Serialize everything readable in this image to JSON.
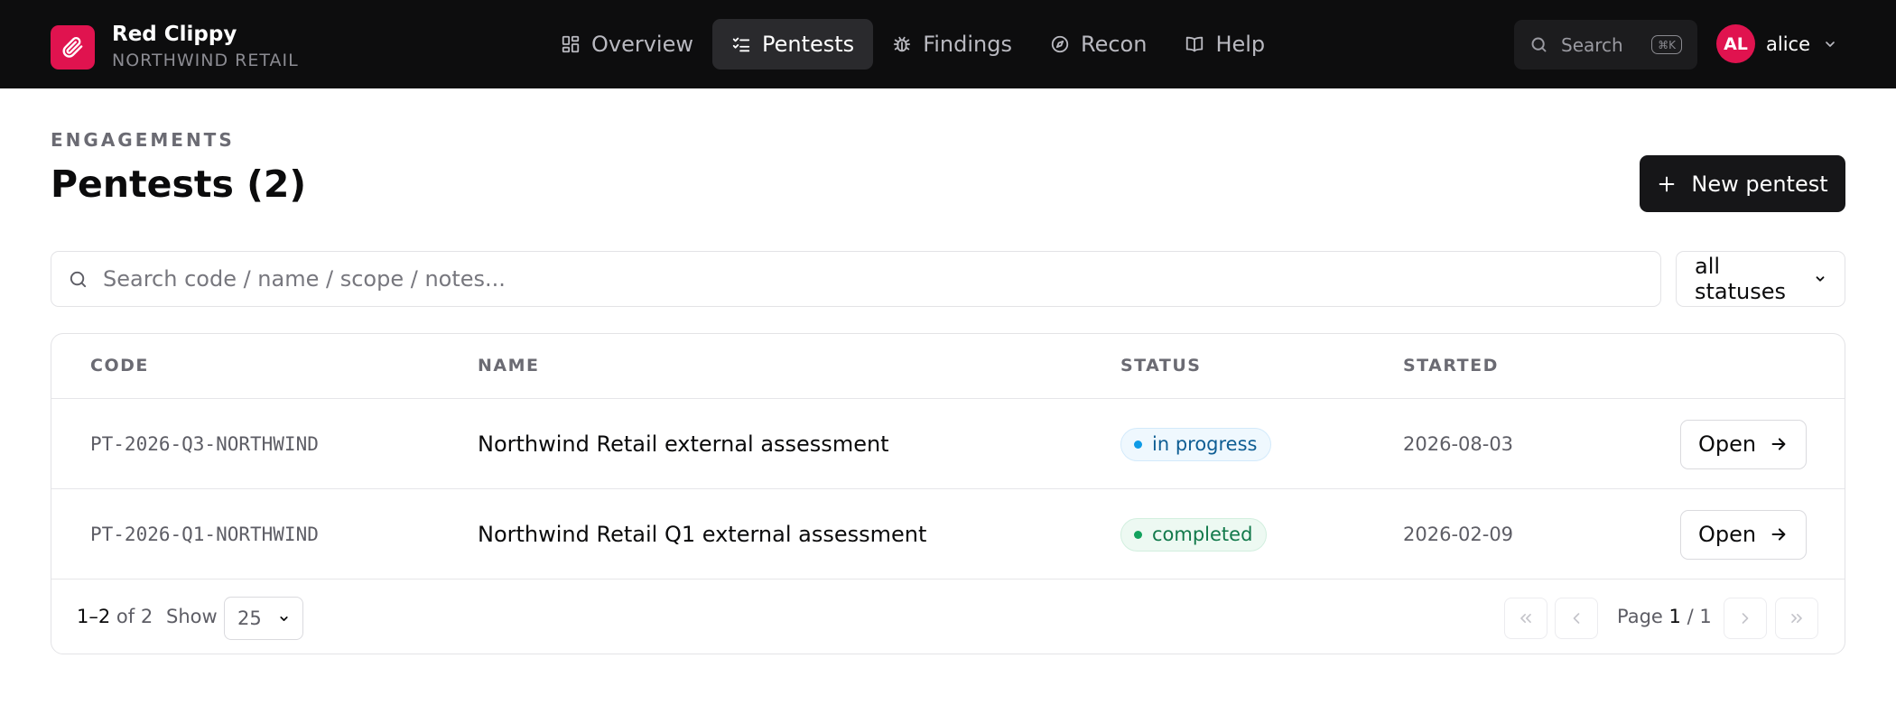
{
  "brand": {
    "name": "Red Clippy",
    "org": "NORTHWIND RETAIL",
    "logo_icon": "paperclip-icon"
  },
  "nav": {
    "items": [
      {
        "label": "Overview",
        "icon": "grid-icon"
      },
      {
        "label": "Pentests",
        "icon": "checklist-icon",
        "active": true
      },
      {
        "label": "Findings",
        "icon": "bug-icon"
      },
      {
        "label": "Recon",
        "icon": "compass-icon"
      },
      {
        "label": "Help",
        "icon": "book-icon"
      }
    ]
  },
  "global_search": {
    "label": "Search",
    "shortcut": "⌘K"
  },
  "user": {
    "initials": "AL",
    "name": "alice"
  },
  "page": {
    "eyebrow": "ENGAGEMENTS",
    "title": "Pentests (2)",
    "new_button": "New pentest"
  },
  "filters": {
    "search_placeholder": "Search code / name / scope / notes...",
    "status_selected": "all statuses"
  },
  "table": {
    "columns": [
      "CODE",
      "NAME",
      "STATUS",
      "STARTED"
    ],
    "rows": [
      {
        "code": "PT-2026-Q3-NORTHWIND",
        "name": "Northwind Retail external assessment",
        "status": "in progress",
        "started": "2026-08-03",
        "action": "Open"
      },
      {
        "code": "PT-2026-Q1-NORTHWIND",
        "name": "Northwind Retail Q1 external assessment",
        "status": "completed",
        "started": "2026-02-09",
        "action": "Open"
      }
    ]
  },
  "pagination": {
    "range": "1–2",
    "of_total": "of 2",
    "show_label": "Show",
    "page_size": "25",
    "page_label": "Page",
    "current_page": "1",
    "total_pages": "/ 1"
  },
  "colors": {
    "accent": "#e0134f",
    "topbar": "#0d0d0e",
    "primary_button": "#161618",
    "status_in_progress": "#0f9be6",
    "status_completed": "#12a25d"
  }
}
